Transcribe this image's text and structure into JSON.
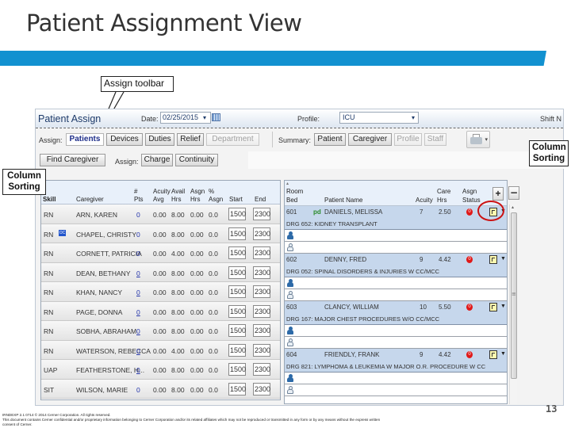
{
  "slide": {
    "title": "Patient Assignment View",
    "page_number": "13",
    "accent_color": "#1291d0"
  },
  "callouts": {
    "assign_toolbar": "Assign toolbar",
    "column_sorting_left": "Column Sorting",
    "column_sorting_right": "Column Sorting"
  },
  "app": {
    "name": "Patient Assign",
    "date_label": "Date:",
    "date_value": "02/25/2015",
    "profile_label": "Profile:",
    "profile_value": "ICU",
    "shift_label": "Shift N",
    "assign_label": "Assign:",
    "assign_tabs": [
      {
        "label": "Patients",
        "state": "active"
      },
      {
        "label": "Devices",
        "state": "normal"
      },
      {
        "label": "Duties",
        "state": "normal"
      },
      {
        "label": "Relief",
        "state": "normal"
      },
      {
        "label": "Department",
        "state": "disabled"
      }
    ],
    "summary_label": "Summary:",
    "summary_buttons": [
      {
        "label": "Patient",
        "state": "normal"
      },
      {
        "label": "Caregiver",
        "state": "normal"
      },
      {
        "label": "Profile",
        "state": "disabled"
      },
      {
        "label": "Staff",
        "state": "disabled"
      }
    ],
    "find_caregiver": "Find Caregiver",
    "assign2_label": "Assign:",
    "charge_button": "Charge",
    "continuity_button": "Continuity",
    "print_icon": "printer-icon"
  },
  "caregiver_grid": {
    "headers": {
      "skill": "Skill",
      "caregiver": "Caregiver",
      "pts_1": "#",
      "pts_2": "Pts",
      "acuity_1": "Acuity",
      "acuity_2": "Avg",
      "avail_1": "Avail",
      "avail_2": "Hrs",
      "asgn_1": "Asgn",
      "asgn_2": "Hrs",
      "pct_1": "%",
      "pct_2": "Asgn",
      "start": "Start",
      "end": "End"
    },
    "rows": [
      {
        "skill": "RN",
        "badge": "",
        "caregiver": "ARN, KAREN",
        "pts": "0",
        "acuity": "0.00",
        "avail": "8.00",
        "asgn": "0.00",
        "pct": "0.0",
        "start": "1500",
        "end": "2300"
      },
      {
        "skill": "RN",
        "badge": "OC",
        "caregiver": "CHAPEL, CHRISTY",
        "pts": "0",
        "acuity": "0.00",
        "avail": "8.00",
        "asgn": "0.00",
        "pct": "0.0",
        "start": "1500",
        "end": "2300"
      },
      {
        "skill": "RN",
        "badge": "",
        "caregiver": "CORNETT, PATRICIA",
        "pts": "0",
        "acuity": "0.00",
        "avail": "4.00",
        "asgn": "0.00",
        "pct": "0.0",
        "start": "1500",
        "end": "2300"
      },
      {
        "skill": "RN",
        "badge": "",
        "caregiver": "DEAN, BETHANY",
        "pts": "0",
        "acuity": "0.00",
        "avail": "8.00",
        "asgn": "0.00",
        "pct": "0.0",
        "start": "1500",
        "end": "2300"
      },
      {
        "skill": "RN",
        "badge": "",
        "caregiver": "KHAN, NANCY",
        "pts": "0",
        "acuity": "0.00",
        "avail": "8.00",
        "asgn": "0.00",
        "pct": "0.0",
        "start": "1500",
        "end": "2300"
      },
      {
        "skill": "RN",
        "badge": "",
        "caregiver": "PAGE, DONNA",
        "pts": "0",
        "acuity": "0.00",
        "avail": "8.00",
        "asgn": "0.00",
        "pct": "0.0",
        "start": "1500",
        "end": "2300"
      },
      {
        "skill": "RN",
        "badge": "",
        "caregiver": "SOBHA, ABRAHAM",
        "pts": "0",
        "acuity": "0.00",
        "avail": "8.00",
        "asgn": "0.00",
        "pct": "0.0",
        "start": "1500",
        "end": "2300"
      },
      {
        "skill": "RN",
        "badge": "",
        "caregiver": "WATERSON, REBECCA",
        "pts": "0",
        "acuity": "0.00",
        "avail": "4.00",
        "asgn": "0.00",
        "pct": "0.0",
        "start": "1500",
        "end": "2300"
      },
      {
        "skill": "UAP",
        "badge": "",
        "caregiver": "FEATHERSTONE, H...",
        "pts": "0",
        "acuity": "0.00",
        "avail": "8.00",
        "asgn": "0.00",
        "pct": "0.0",
        "start": "1500",
        "end": "2300"
      },
      {
        "skill": "SIT",
        "badge": "",
        "caregiver": "WILSON, MARIE",
        "pts": "0",
        "acuity": "0.00",
        "avail": "8.00",
        "asgn": "0.00",
        "pct": "0.0",
        "start": "1500",
        "end": "2300"
      }
    ]
  },
  "patient_grid": {
    "headers": {
      "room_1": "Room",
      "room_2": "Bed",
      "patient": "Patient Name",
      "acuity": "Acuity",
      "care_1": "Care",
      "care_2": "Hrs",
      "status_1": "Asgn",
      "status_2": "Status",
      "plus": "+",
      "minus": "−"
    },
    "rows": [
      {
        "room": "601",
        "tag": "pd",
        "patient": "DANIELS, MELISSA",
        "acuity": "7",
        "care": "2.50",
        "status": "0",
        "drg": "DRG 652: KIDNEY TRANSPLANT"
      },
      {
        "room": "602",
        "tag": "",
        "patient": "DENNY, FRED",
        "acuity": "9",
        "care": "4.42",
        "status": "0",
        "drg": "DRG 052: SPINAL DISORDERS & INJURIES W CC/MCC"
      },
      {
        "room": "603",
        "tag": "",
        "patient": "CLANCY, WILLIAM",
        "acuity": "10",
        "care": "5.50",
        "status": "0",
        "drg": "DRG 167: MAJOR CHEST PROCEDURES W/O CC/MCC"
      },
      {
        "room": "604",
        "tag": "",
        "patient": "FRIENDLY, FRANK",
        "acuity": "9",
        "care": "4.42",
        "status": "0",
        "drg": "DRG 821: LYMPHOMA & LEUKEMIA W MAJOR O.R. PROCEDURE W CC"
      }
    ]
  },
  "footer": {
    "line1": "IRNDEXP 2.1 0714   © 2014 Cerner Corporation. All rights reserved.",
    "line2": "This document contains Cerner confidential and/or proprietary information belonging to Cerner Corporation and/or its related affiliates which may not be reproduced or transmitted in any form or by any means without the express written",
    "line3": "consent of Cerner."
  }
}
